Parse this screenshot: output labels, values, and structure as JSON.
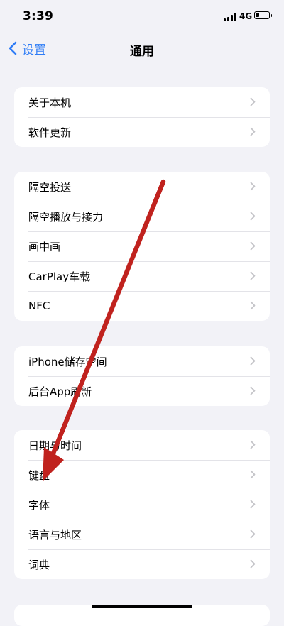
{
  "status_bar": {
    "time": "3:39",
    "network": "4G",
    "battery_level": 0.3
  },
  "nav": {
    "back_label": "设置",
    "title": "通用"
  },
  "groups": [
    {
      "items": [
        {
          "label": "关于本机"
        },
        {
          "label": "软件更新"
        }
      ]
    },
    {
      "items": [
        {
          "label": "隔空投送"
        },
        {
          "label": "隔空播放与接力"
        },
        {
          "label": "画中画"
        },
        {
          "label": "CarPlay车载"
        },
        {
          "label": "NFC"
        }
      ]
    },
    {
      "items": [
        {
          "label": "iPhone储存空间"
        },
        {
          "label": "后台App刷新"
        }
      ]
    },
    {
      "items": [
        {
          "label": "日期与时间"
        },
        {
          "label": "键盘"
        },
        {
          "label": "字体"
        },
        {
          "label": "语言与地区"
        },
        {
          "label": "词典"
        }
      ]
    }
  ],
  "colors": {
    "accent": "#2E7CF6",
    "background": "#F2F2F7",
    "annotation_arrow": "#C0221E"
  },
  "icons": {
    "back": "chevron-left-icon",
    "row": "chevron-right-icon"
  }
}
